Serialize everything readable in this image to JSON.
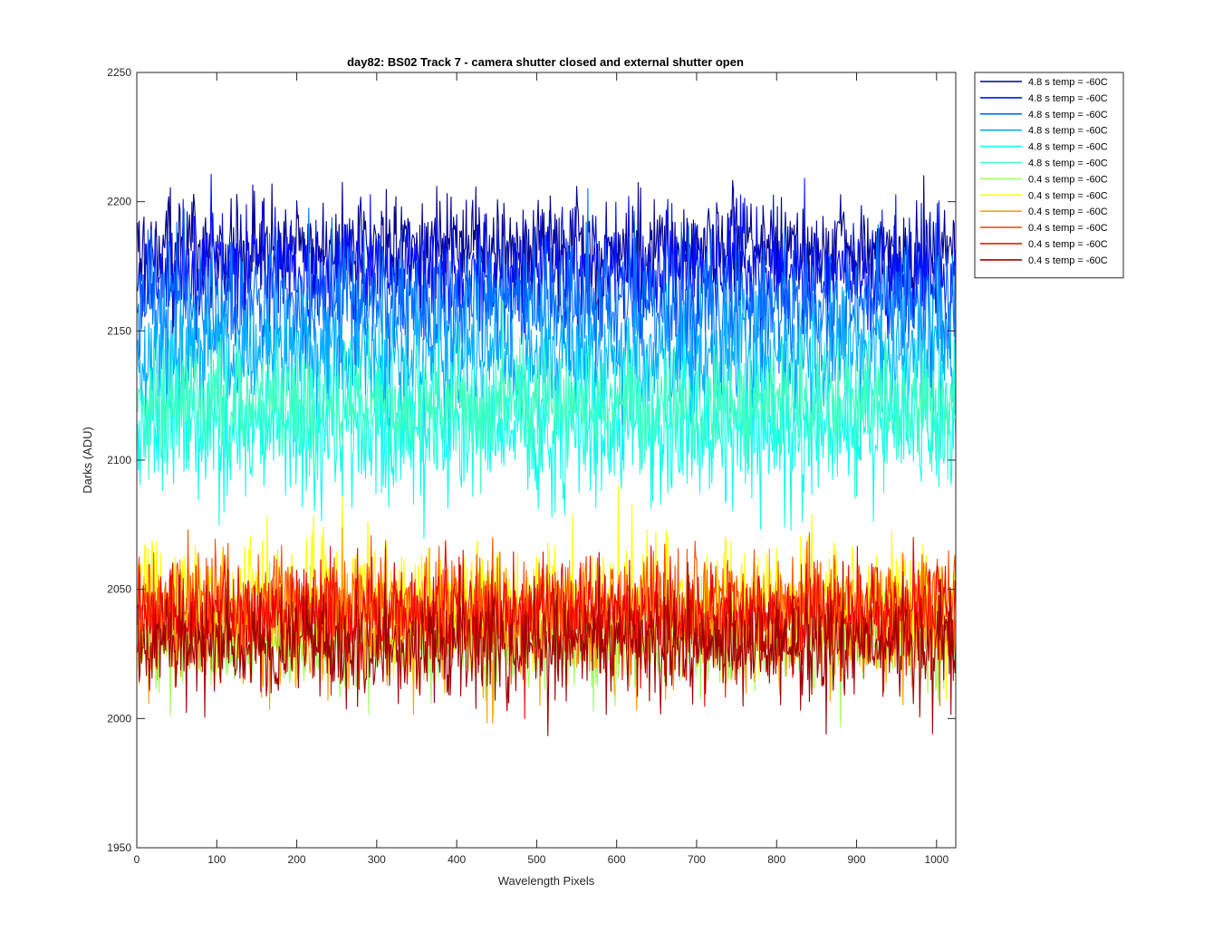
{
  "chart_data": {
    "type": "line",
    "title": "day82: BS02  Track 7 - camera shutter closed and external shutter open",
    "xlabel": "Wavelength Pixels",
    "ylabel": "Darks (ADU)",
    "xlim": [
      0,
      1024
    ],
    "ylim": [
      1950,
      2250
    ],
    "xticks": [
      0,
      100,
      200,
      300,
      400,
      500,
      600,
      700,
      800,
      900,
      1000
    ],
    "yticks": [
      1950,
      2000,
      2050,
      2100,
      2150,
      2200,
      2250
    ],
    "grid": false,
    "legend_position": "outside-top-right",
    "series": [
      {
        "name": "4.8 s temp = -60C",
        "color": "#00008f",
        "mean": 2182,
        "amplitude": 10,
        "min": 2148,
        "max": 2216
      },
      {
        "name": "4.8 s temp = -60C",
        "color": "#0010ff",
        "mean": 2172,
        "amplitude": 11,
        "min": 2135,
        "max": 2212
      },
      {
        "name": "4.8 s temp = -60C",
        "color": "#0070ff",
        "mean": 2160,
        "amplitude": 12,
        "min": 2118,
        "max": 2205
      },
      {
        "name": "4.8 s temp = -60C",
        "color": "#00b0ff",
        "mean": 2140,
        "amplitude": 12,
        "min": 2100,
        "max": 2185
      },
      {
        "name": "4.8 s temp = -60C",
        "color": "#10ffef",
        "mean": 2112,
        "amplitude": 14,
        "min": 2068,
        "max": 2160
      },
      {
        "name": "4.8 s temp = -60C",
        "color": "#40ffbf",
        "mean": 2122,
        "amplitude": 11,
        "min": 2085,
        "max": 2162
      },
      {
        "name": "0.4 s temp = -60C",
        "color": "#9fff60",
        "mean": 2030,
        "amplitude": 9,
        "min": 1995,
        "max": 2065
      },
      {
        "name": "0.4 s temp = -60C",
        "color": "#ffff00",
        "mean": 2046,
        "amplitude": 11,
        "min": 2005,
        "max": 2105
      },
      {
        "name": "0.4 s temp = -60C",
        "color": "#ffa000",
        "mean": 2036,
        "amplitude": 10,
        "min": 1995,
        "max": 2095
      },
      {
        "name": "0.4 s temp = -60C",
        "color": "#ff5000",
        "mean": 2044,
        "amplitude": 10,
        "min": 2005,
        "max": 2100
      },
      {
        "name": "0.4 s temp = -60C",
        "color": "#ef0000",
        "mean": 2040,
        "amplitude": 10,
        "min": 2000,
        "max": 2090
      },
      {
        "name": "0.4 s temp = -60C",
        "color": "#9f0000",
        "mean": 2028,
        "amplitude": 10,
        "min": 1972,
        "max": 2078
      }
    ]
  }
}
